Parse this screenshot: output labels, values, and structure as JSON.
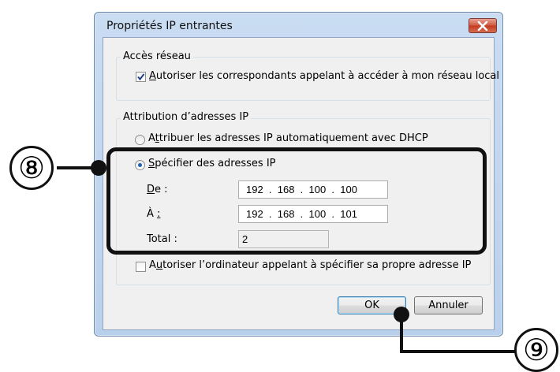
{
  "dialog": {
    "title": "Propriétés IP entrantes",
    "close_icon": "close-x-icon"
  },
  "network_access": {
    "legend": "Accès réseau",
    "allow_lan_checked": true,
    "allow_lan_label_accel": "A",
    "allow_lan_label_rest": "utoriser les correspondants appelant à accéder à mon réseau local"
  },
  "ip_assignment": {
    "legend": "Attribution d’adresses IP",
    "dhcp_label_pre": "A",
    "dhcp_label_accel": "t",
    "dhcp_label_rest": "tribuer les adresses IP automatiquement avec DHCP",
    "dhcp_selected": false,
    "specify_label_accel": "S",
    "specify_label_rest": "pécifier des adresses IP",
    "specify_selected": true,
    "from_label_accel": "D",
    "from_label_rest": "e :",
    "from_value": "192  .  168  .  100  .  100",
    "to_label_pre": "À ",
    "to_label_accel": ":",
    "to_value": "192  .  168  .  100  .  101",
    "total_label": "Total :",
    "total_value": "2",
    "allow_caller_checked": false,
    "allow_caller_pre": "A",
    "allow_caller_accel": "u",
    "allow_caller_rest": "toriser l’ordinateur appelant à spécifier sa propre adresse IP"
  },
  "buttons": {
    "ok": "OK",
    "cancel": "Annuler"
  },
  "annotations": {
    "marker_8": "⑧",
    "marker_9": "⑨"
  }
}
